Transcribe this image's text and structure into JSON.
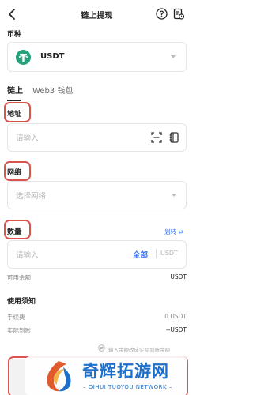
{
  "header": {
    "title": "链上提现",
    "back_icon": "chevron-left-icon",
    "help_icon": "question-circle-icon",
    "records_icon": "records-icon"
  },
  "currency": {
    "label": "币种",
    "selected": "USDT",
    "logo_icon": "tether-logo-icon",
    "logo_color": "#26a17b"
  },
  "tabs": [
    {
      "label": "链上",
      "active": true
    },
    {
      "label": "Web3 钱包",
      "active": false
    }
  ],
  "address": {
    "label": "地址",
    "placeholder": "请输入",
    "scan_icon": "scan-icon",
    "address_book_icon": "address-book-icon"
  },
  "network": {
    "label": "网络",
    "placeholder": "选择网络"
  },
  "amount": {
    "label": "数量",
    "transfer_link": "划转 ⇄",
    "placeholder": "请输入",
    "all_label": "全部",
    "unit": "USDT",
    "available_label": "可用余额",
    "available_unit": "USDT"
  },
  "notice": {
    "title": "使用须知",
    "fee_label": "手续费",
    "fee_value": "0 USDT",
    "receive_label": "实际到账",
    "receive_value": "--USDT",
    "hint": "输入金额改成实际到账金额"
  },
  "watermark": {
    "main": "奇辉拓游网",
    "sub": "QIHUI TUOYOU NETWORK",
    "accent_color": "#e05a2b",
    "text_color": "#1e6fc9"
  },
  "colors": {
    "annotation_red": "#d9534f",
    "link_blue": "#2f6bff"
  }
}
